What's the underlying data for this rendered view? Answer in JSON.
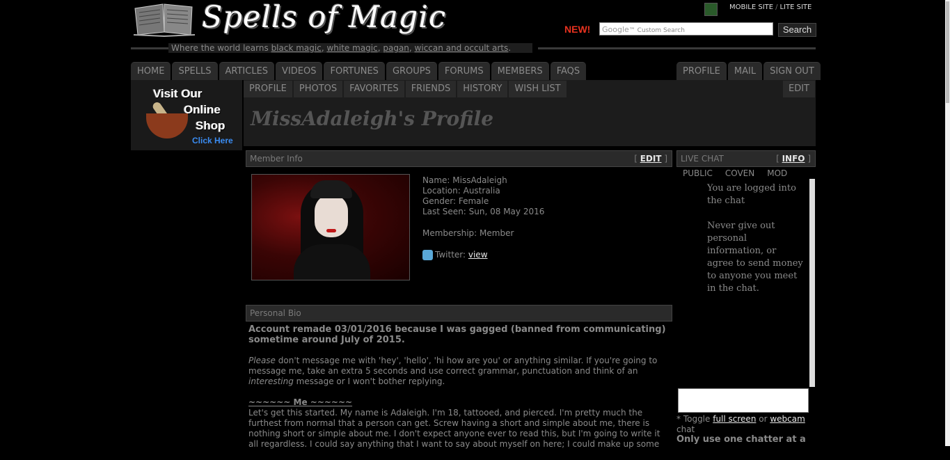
{
  "header": {
    "logo_text": "Spells of Magic",
    "tagline_prefix": "Where the world learns ",
    "tagline_links": [
      "black magic",
      "white magic",
      "pagan",
      "wiccan and occult arts"
    ],
    "tagline_suffix": ".",
    "top_links": [
      "MOBILE SITE",
      "LITE SITE"
    ],
    "new_label": "NEW!",
    "search_placeholder": "Custom Search",
    "search_brand": "Google",
    "search_button": "Search"
  },
  "nav": {
    "left_tabs": [
      "HOME",
      "SPELLS",
      "ARTICLES",
      "VIDEOS",
      "FORTUNES",
      "GROUPS",
      "FORUMS",
      "MEMBERS",
      "FAQS"
    ],
    "right_tabs": [
      "PROFILE",
      "MAIL",
      "SIGN OUT"
    ],
    "sub_tabs": [
      "PROFILE",
      "PHOTOS",
      "FAVORITES",
      "FRIENDS",
      "HISTORY",
      "WISH LIST"
    ],
    "sub_edit": "EDIT"
  },
  "shop_ad": {
    "line1": "Visit Our",
    "line2": "Online",
    "line3": "Shop",
    "click": "Click Here"
  },
  "profile": {
    "title": "MissAdaleigh's Profile",
    "member_info_label": "Member Info",
    "edit_label": "EDIT",
    "name": "Name: MissAdaleigh",
    "location": "Location: Australia",
    "gender": "Gender: Female",
    "last_seen": "Last Seen: Sun, 08 May 2016",
    "membership": "Membership: Member",
    "twitter_label": "Twitter: ",
    "twitter_link": "view"
  },
  "bio": {
    "heading": "Personal Bio",
    "lead": "Account remade 03/01/2016 because I was gagged (banned from communicating) sometime around July of 2015.",
    "para1_em": "Please",
    "para1": " don't message me with 'hey', 'hello', 'hi how are you' or anything similar. If you're going to message me, take an extra 5 seconds and use correct grammar, punctuation and think of an ",
    "para1_em2": "interesting",
    "para1_end": " message or I won't bother replying.",
    "me_title": "~~~~~~ Me ~~~~~~",
    "me_text": "Let's get this started. My name is Adaleigh. I'm 18, tattooed, and pierced. I'm pretty much the furthest from normal that a person can get. Screw having a short and simple about me, there is nothing short or simple about me. I don't expect anyone ever to read this, but I'm going to write it all regardless. I could say anything that I want to say about myself on here; I could make up some"
  },
  "chat": {
    "heading": "LIVE CHAT",
    "info_label": "INFO",
    "tabs": [
      "PUBLIC",
      "COVEN",
      "MOD"
    ],
    "msg1": "You are logged into the chat",
    "msg2": "Never give out personal information, or agree to send money to anyone you meet in the chat.",
    "toggle_prefix": "* Toggle ",
    "toggle_full": "full screen",
    "toggle_or": " or ",
    "toggle_webcam": "webcam",
    "toggle_suffix": " chat",
    "warn": "Only use one chatter at a"
  }
}
